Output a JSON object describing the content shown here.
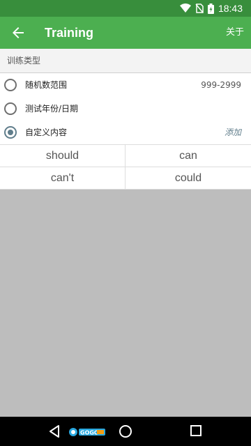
{
  "status_bar": {
    "time": "18:43"
  },
  "app_bar": {
    "title": "Training",
    "action_label": "关于"
  },
  "section": {
    "title": "训练类型"
  },
  "options": [
    {
      "label": "随机数范围",
      "value": "999-2999",
      "selected": false
    },
    {
      "label": "测试年份/日期",
      "selected": false
    },
    {
      "label": "自定义内容",
      "action": "添加",
      "selected": true
    }
  ],
  "custom_words": [
    "should",
    "can",
    "can't",
    "could"
  ],
  "colors": {
    "status_bar": "#388e3c",
    "app_bar": "#4caf50",
    "radio_checked": "#607d8b",
    "background": "#bdbdbd"
  },
  "icons": [
    "wifi-icon",
    "no-sim-icon",
    "battery-charging-icon",
    "back-arrow-icon",
    "nav-back-icon",
    "nav-home-icon",
    "nav-recents-icon"
  ],
  "watermark": {
    "logo_text": "GOGO手游网"
  }
}
